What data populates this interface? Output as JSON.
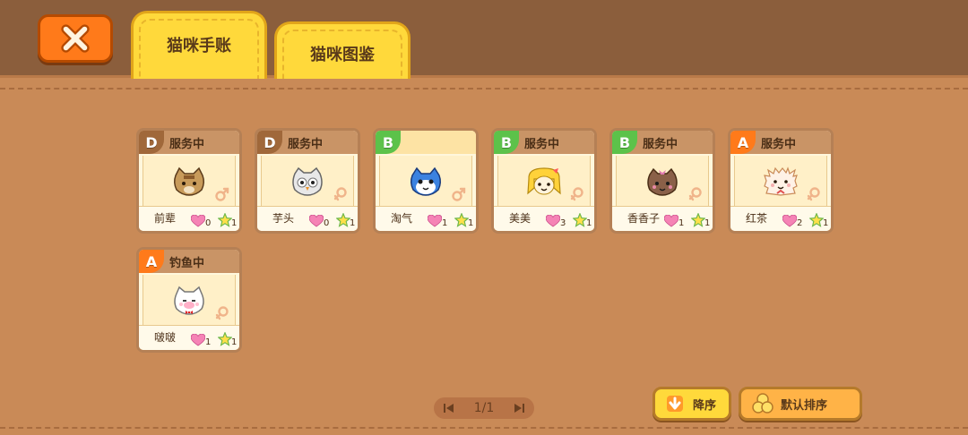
{
  "tabs": [
    {
      "label": "猫咪手账",
      "active": true
    },
    {
      "label": "猫咪图鉴",
      "active": false
    }
  ],
  "cats": [
    {
      "grade": "D",
      "status": "服务中",
      "name": "前辈",
      "hearts": "0",
      "stars": "1",
      "gender": "male",
      "cat": "tabby"
    },
    {
      "grade": "D",
      "status": "服务中",
      "name": "芋头",
      "hearts": "0",
      "stars": "1",
      "gender": "female",
      "cat": "owl"
    },
    {
      "grade": "B",
      "status": "",
      "name": "淘气",
      "hearts": "1",
      "stars": "1",
      "gender": "male",
      "cat": "blue"
    },
    {
      "grade": "B",
      "status": "服务中",
      "name": "美美",
      "hearts": "3",
      "stars": "1",
      "gender": "female",
      "cat": "blonde"
    },
    {
      "grade": "B",
      "status": "服务中",
      "name": "香香子",
      "hearts": "1",
      "stars": "1",
      "gender": "female",
      "cat": "brown"
    },
    {
      "grade": "A",
      "status": "服务中",
      "name": "红茶",
      "hearts": "2",
      "stars": "1",
      "gender": "female",
      "cat": "fluffy"
    },
    {
      "grade": "A",
      "status": "钓鱼中",
      "name": "啵啵",
      "hearts": "1",
      "stars": "1",
      "gender": "female",
      "cat": "white"
    }
  ],
  "pager": {
    "label": "1/1"
  },
  "sort": {
    "desc_label": "降序",
    "default_label": "默认排序"
  },
  "icons": {
    "close": "close-icon",
    "heart": "heart-icon",
    "star": "star-icon",
    "male": "male-icon",
    "female": "female-icon",
    "prev": "first-page-icon",
    "next": "last-page-icon",
    "down_arrow": "down-arrow-icon",
    "coins": "coins-icon"
  },
  "colors": {
    "grade_D": "#a0683a",
    "grade_B": "#5cc24a",
    "grade_A": "#ff7a1a",
    "tab_yellow": "#ffd93b",
    "close_orange": "#ff7a1a"
  }
}
